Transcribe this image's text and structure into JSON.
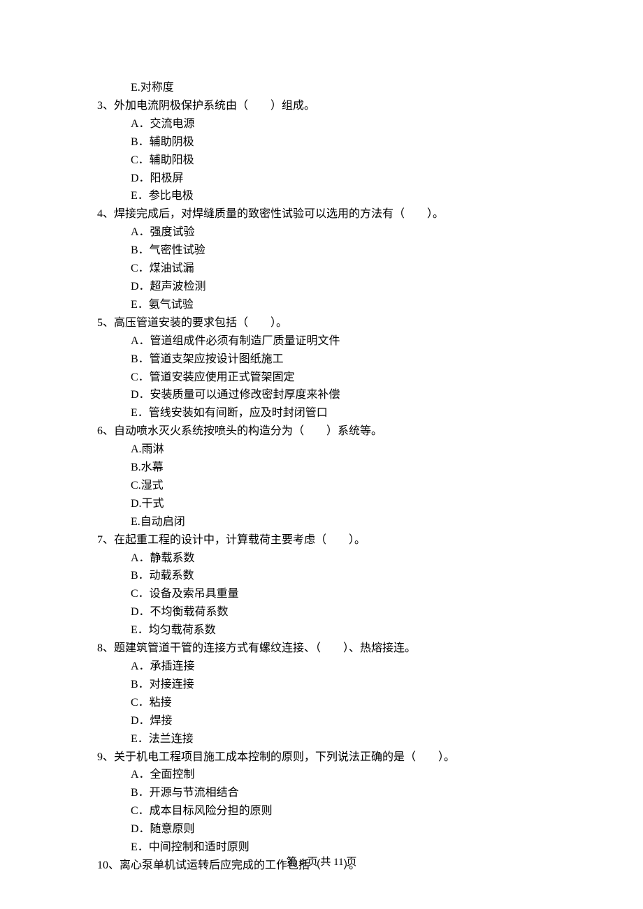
{
  "trailing_option": {
    "label": "E.对称度"
  },
  "questions": [
    {
      "num": "3、",
      "text": "外加电流阴极保护系统由（　　）组成。",
      "options": [
        "A．交流电源",
        "B．辅助阴极",
        "C．辅助阳极",
        "D．阳极屏",
        "E．参比电极"
      ]
    },
    {
      "num": "4、",
      "text": "焊接完成后，对焊缝质量的致密性试验可以选用的方法有（　　）。",
      "options": [
        "A．强度试验",
        "B．气密性试验",
        "C．煤油试漏",
        "D．超声波检测",
        "E．氨气试验"
      ]
    },
    {
      "num": "5、",
      "text": "高压管道安装的要求包括（　　）。",
      "options": [
        "A．管道组成件必须有制造厂质量证明文件",
        "B．管道支架应按设计图纸施工",
        "C．管道安装应使用正式管架固定",
        "D．安装质量可以通过修改密封厚度来补偿",
        "E．管线安装如有间断，应及时封闭管口"
      ]
    },
    {
      "num": "6、",
      "text": "自动喷水灭火系统按喷头的构造分为（　　）系统等。",
      "options": [
        "A.雨淋",
        "B.水幕",
        "C.湿式",
        "D.干式",
        "E.自动启闭"
      ]
    },
    {
      "num": "7、",
      "text": "在起重工程的设计中，计算载荷主要考虑（　　）。",
      "options": [
        "A．静载系数",
        "B．动载系数",
        "C．设备及索吊具重量",
        "D．不均衡载荷系数",
        "E．均匀载荷系数"
      ]
    },
    {
      "num": "8、",
      "text": "题建筑管道干管的连接方式有螺纹连接、（　　）、热熔接连。",
      "options": [
        "A．承插连接",
        "B．对接连接",
        "C．粘接",
        "D．焊接",
        "E．法兰连接"
      ]
    },
    {
      "num": "9、",
      "text": "关于机电工程项目施工成本控制的原则，下列说法正确的是（　　）。",
      "options": [
        "A．全面控制",
        "B．开源与节流相结合",
        "C．成本目标风险分担的原则",
        "D．随意原则",
        "E．中间控制和适时原则"
      ]
    },
    {
      "num": "10、",
      "text": "离心泵单机试运转后应完成的工作包括（　　）。",
      "options": []
    }
  ],
  "footer": "第 4 页 共 11 页"
}
